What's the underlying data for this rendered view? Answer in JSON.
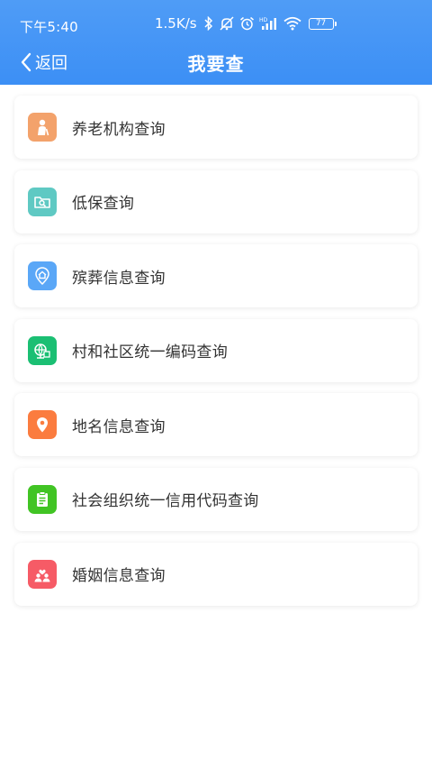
{
  "status": {
    "time": "下午5:40",
    "net_speed": "1.5K/s",
    "battery": "77"
  },
  "nav": {
    "back_label": "返回",
    "title": "我要查"
  },
  "items": [
    {
      "label": "养老机构查询",
      "icon": "elderly-person-icon",
      "color": "#f3a26b"
    },
    {
      "label": "低保查询",
      "icon": "folder-search-icon",
      "color": "#5fc9c3"
    },
    {
      "label": "殡葬信息查询",
      "icon": "house-location-icon",
      "color": "#5aa7f7"
    },
    {
      "label": "村和社区统一编码查询",
      "icon": "globe-code-icon",
      "color": "#1bbf73"
    },
    {
      "label": "地名信息查询",
      "icon": "location-pin-icon",
      "color": "#fb7c3f"
    },
    {
      "label": "社会组织统一信用代码查询",
      "icon": "clipboard-icon",
      "color": "#41c424"
    },
    {
      "label": "婚姻信息查询",
      "icon": "couple-heart-icon",
      "color": "#f65b66"
    }
  ]
}
